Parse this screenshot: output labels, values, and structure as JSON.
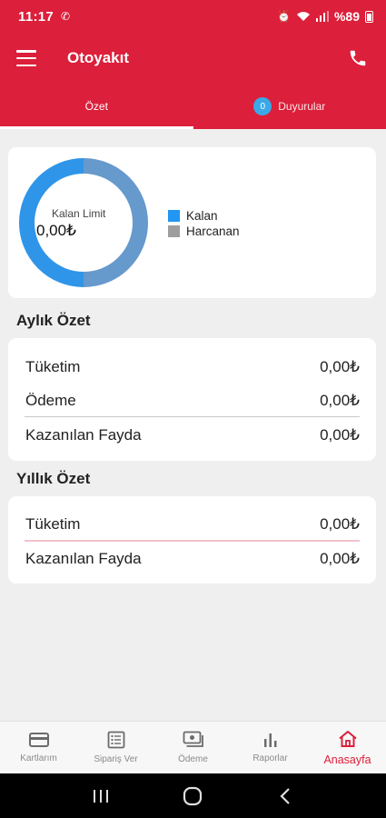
{
  "status": {
    "time": "11:17",
    "battery": "%89"
  },
  "app": {
    "title": "Otoyakıt"
  },
  "tabs": [
    {
      "label": "Özet"
    },
    {
      "label": "Duyurular",
      "badge": "0"
    }
  ],
  "limit": {
    "label": "Kalan Limit",
    "value": "0,00₺",
    "legend": [
      {
        "label": "Kalan",
        "color": "#2196f3"
      },
      {
        "label": "Harcanan",
        "color": "#9e9e9e"
      }
    ]
  },
  "monthly": {
    "title": "Aylık Özet",
    "rows": [
      {
        "label": "Tüketim",
        "value": "0,00₺"
      },
      {
        "label": "Ödeme",
        "value": "0,00₺"
      },
      {
        "label": "Kazanılan Fayda",
        "value": "0,00₺"
      }
    ]
  },
  "yearly": {
    "title": "Yıllık Özet",
    "rows": [
      {
        "label": "Tüketim",
        "value": "0,00₺"
      },
      {
        "label": "Kazanılan Fayda",
        "value": "0,00₺"
      }
    ]
  },
  "nav": [
    {
      "label": "Kartlarım",
      "icon": "card-icon"
    },
    {
      "label": "Sipariş Ver",
      "icon": "order-list-icon"
    },
    {
      "label": "Ödeme",
      "icon": "payment-icon"
    },
    {
      "label": "Raporlar",
      "icon": "bar-chart-icon"
    },
    {
      "label": "Anasayfa",
      "icon": "home-icon"
    }
  ],
  "colors": {
    "brand": "#dc1f3a",
    "accent": "#3aa9e8"
  }
}
